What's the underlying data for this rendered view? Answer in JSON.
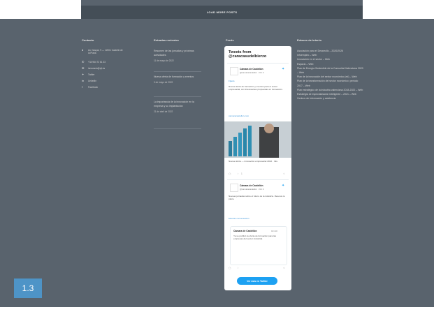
{
  "load_more": {
    "label": "LOAD MORE POSTS"
  },
  "footer": {
    "contact": {
      "title": "Contacto",
      "items": [
        {
          "icon": "map-pin-icon",
          "text": "Av. Gaspar, 9 — 12001 Castelló de la Plana"
        },
        {
          "icon": "phone-icon",
          "text": "+34 964 72 61 33"
        },
        {
          "icon": "email-icon",
          "text": "innovacio@uji.es"
        },
        {
          "icon": "twitter-icon",
          "text": "Twitter"
        },
        {
          "icon": "linkedin-icon",
          "text": "LinkedIn"
        },
        {
          "icon": "facebook-icon",
          "text": "Facebook"
        }
      ]
    },
    "recent": {
      "title": "Entradas recientes",
      "posts": [
        {
          "text": "Resumen de las jornadas y próximas actividades",
          "date": "11 de mayo de 2022"
        },
        {
          "text": "Nueva oferta de formación y eventos",
          "date": "3 de mayo de 2022"
        },
        {
          "text": "La importancia de la innovación en la empresa y su implantación",
          "date": "21 de abril de 2022"
        }
      ]
    },
    "feed_title": "Feeds",
    "partners": {
      "title": "Enlaces de interés",
      "items": [
        "Asociación para el Desarrollo – 2020/2026",
        "Infoempleo – Web",
        "Innovación en el sector – Web",
        "Espacio – Web",
        "Plan de Energía Sostenible de la Comunitat Valenciana 2020 – Web",
        "Plan de la innovación del sector económico (ed) – Web",
        "Plan de la transformación del sector económico: periodo 2017 – Web",
        "Plan estratégico de la industria valenciana 2018-2022 – Web",
        "Estrategia de especialización inteligente – 2021 – Web",
        "Centros de información y asistencia"
      ]
    }
  },
  "twitter": {
    "header": "Tweets from @caracasudelbierzo",
    "pinned": "Fijado",
    "tweet1": {
      "name": "Cámara de Castellón",
      "handle": "@camaracastellon · Dic 2",
      "text": "Nueva oferta de formación y eventos para el sector empresarial, con interesantes propuestas en innovación.",
      "link": "camaracastellon.com",
      "caption": "Nueva oferta — innovación empresarial 2022 · Info."
    },
    "tweet2": {
      "name": "Cámara de Castellón",
      "handle": "@camaracastellon · Dic 2",
      "text": "Nuevas jornadas sobre el futuro de la industria. Reserva tu plaza.",
      "show_thread": "Mostrar conversación"
    },
    "quote": {
      "name": "Cámara de Castellón",
      "date": "Oct 10",
      "text": "Ya se publicó la oferta de formación para las empresas del sector industrial."
    },
    "actions": {
      "reply": "",
      "retweet": "",
      "like": "1",
      "share": ""
    },
    "view_button": "Ver más en Twitter"
  },
  "badge": {
    "label": "1.3"
  },
  "colors": {
    "background": "#59636d",
    "load_more_bar": "#444e57",
    "twitter_blue": "#1da1f2",
    "badge": "#4e94c7"
  }
}
